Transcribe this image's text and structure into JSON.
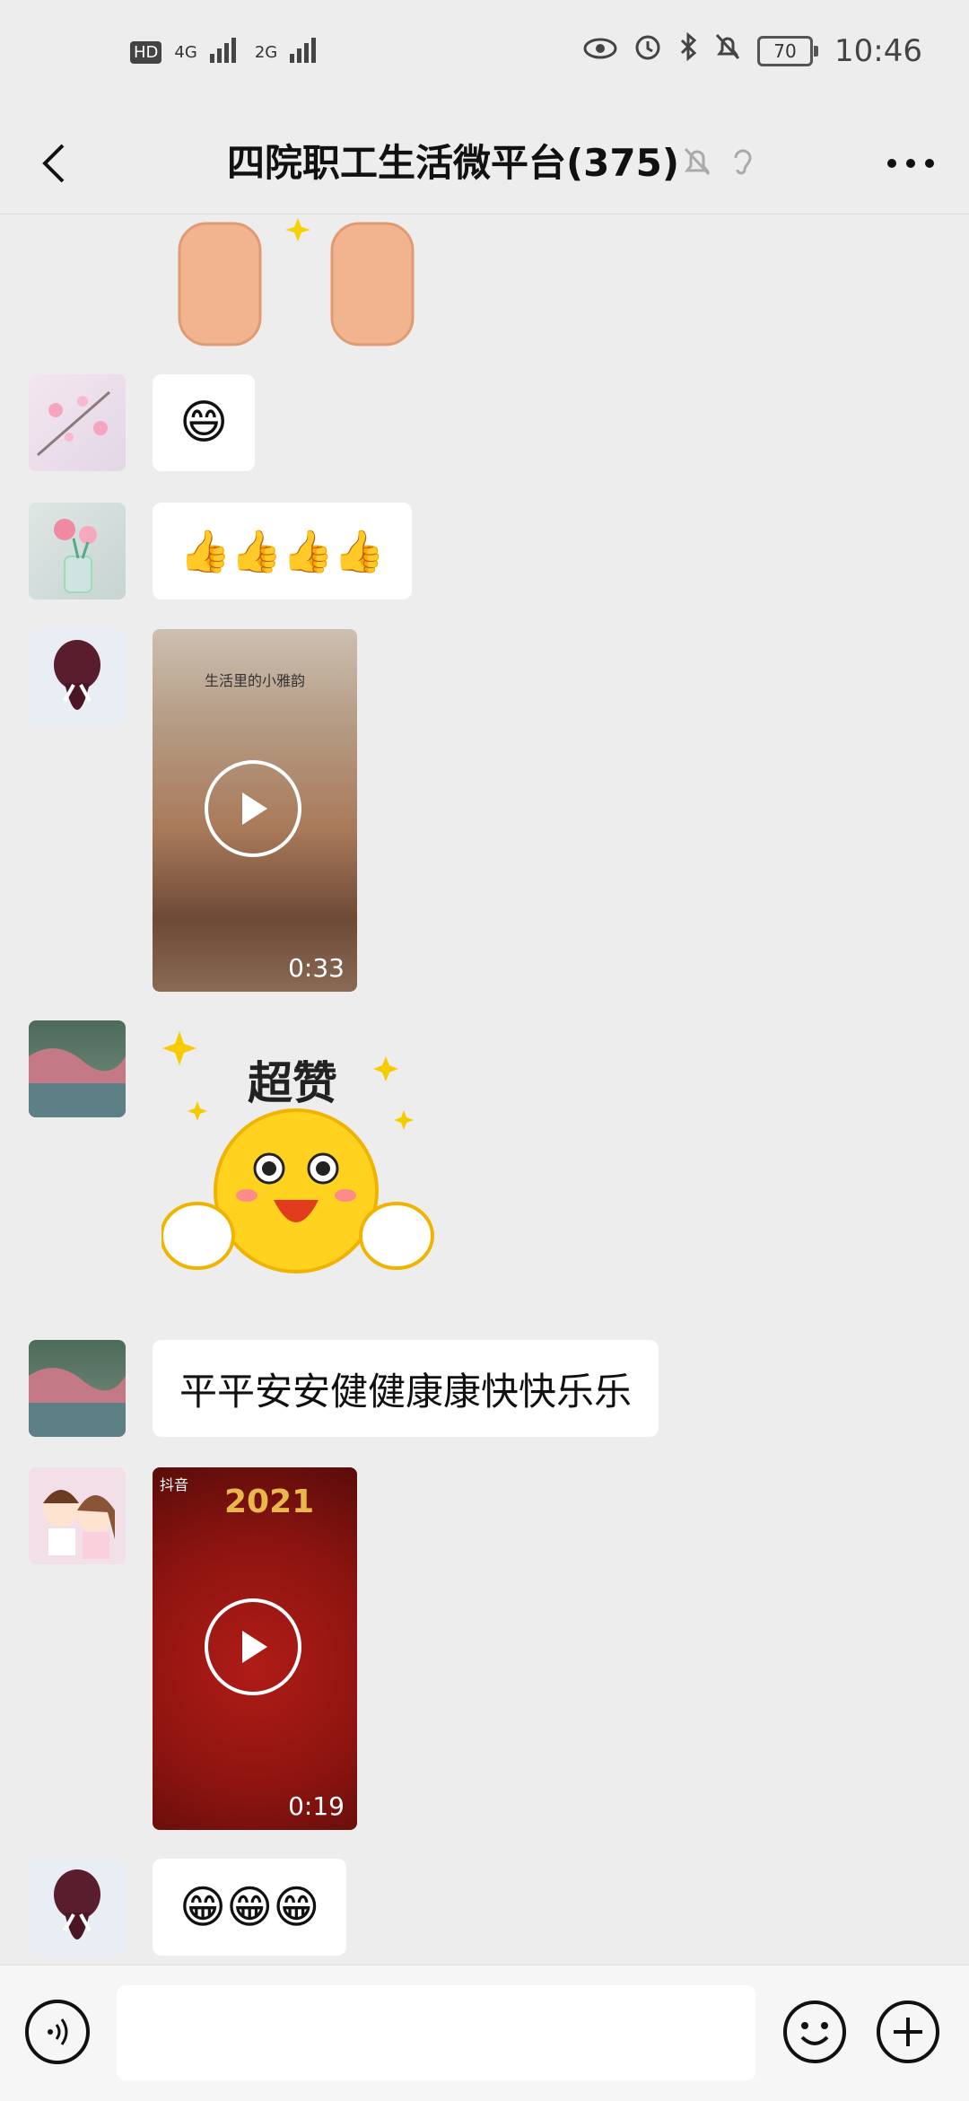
{
  "status": {
    "left_badges": [
      "HD",
      "4G",
      "2G"
    ],
    "battery": "70",
    "time": "10:46"
  },
  "header": {
    "title": "四院职工生活微平台(375)"
  },
  "messages": {
    "m2_emoji": "😄",
    "m3_emoji": "👍👍👍👍",
    "m4_duration": "0:33",
    "m4_video_text": "生活里的小雅韵",
    "m5_sticker_text": "超赞",
    "m6_text": "平平安安健健康康快快乐乐",
    "m7_duration": "0:19",
    "m7_badge": "抖音",
    "m7_year": "2021",
    "m8_emoji": "😁😁😁"
  },
  "colors": {
    "background": "#ededed",
    "bubble": "#ffffff"
  }
}
